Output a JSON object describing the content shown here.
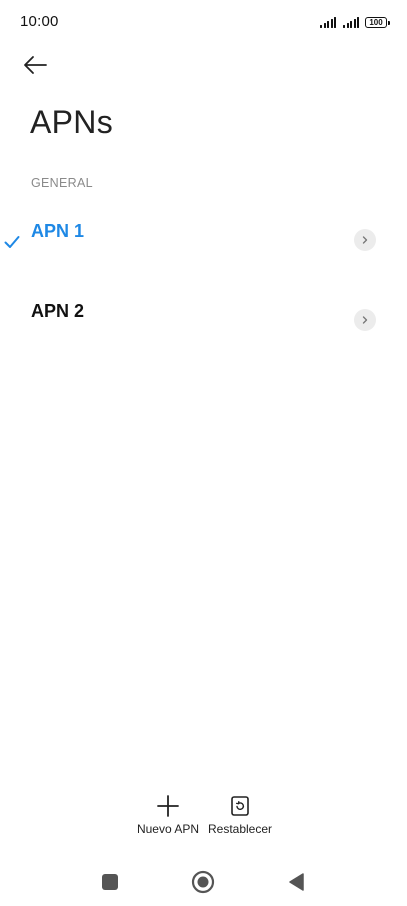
{
  "status_bar": {
    "time": "10:00",
    "battery": "100",
    "icons": [
      "signal-sim1-icon",
      "signal-sim2-icon",
      "battery-icon"
    ]
  },
  "header": {
    "back_icon": "arrow-left-icon",
    "title": "APNs"
  },
  "section": {
    "header": "GENERAL"
  },
  "apns": [
    {
      "label": "APN 1",
      "selected": true,
      "color": "#1e88e5"
    },
    {
      "label": "APN 2",
      "selected": false,
      "color": "#111111"
    }
  ],
  "actions": {
    "new_apn": {
      "label": "Nuevo APN",
      "icon": "plus-icon"
    },
    "reset": {
      "label": "Restablecer",
      "icon": "reset-icon"
    }
  },
  "nav": {
    "icons": [
      "recents-square-icon",
      "home-circle-icon",
      "back-triangle-icon"
    ]
  },
  "colors": {
    "accent": "#1e88e5",
    "section_header": "#8a8a8a",
    "chevron_bg": "#ececec"
  }
}
